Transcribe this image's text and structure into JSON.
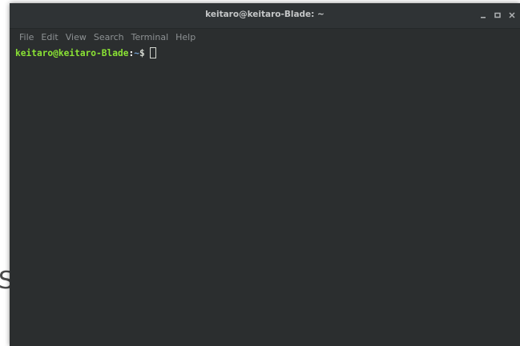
{
  "background": {
    "fragment_text": "S"
  },
  "window": {
    "title": "keitaro@keitaro-Blade: ~",
    "controls": {
      "minimize_icon": "minimize-icon",
      "maximize_icon": "maximize-icon",
      "close_icon": "close-icon"
    }
  },
  "menubar": {
    "items": [
      {
        "label": "File"
      },
      {
        "label": "Edit"
      },
      {
        "label": "View"
      },
      {
        "label": "Search"
      },
      {
        "label": "Terminal"
      },
      {
        "label": "Help"
      }
    ]
  },
  "terminal": {
    "prompt": {
      "user_host": "keitaro@keitaro-Blade",
      "separator": ":",
      "path": "~",
      "symbol": "$"
    }
  },
  "colors": {
    "window_bg": "#2b2e2f",
    "titlebar_bg": "#2f3335",
    "prompt_user_host": "#8ae234",
    "prompt_path": "#729fcf",
    "menu_text": "#8d9193"
  }
}
